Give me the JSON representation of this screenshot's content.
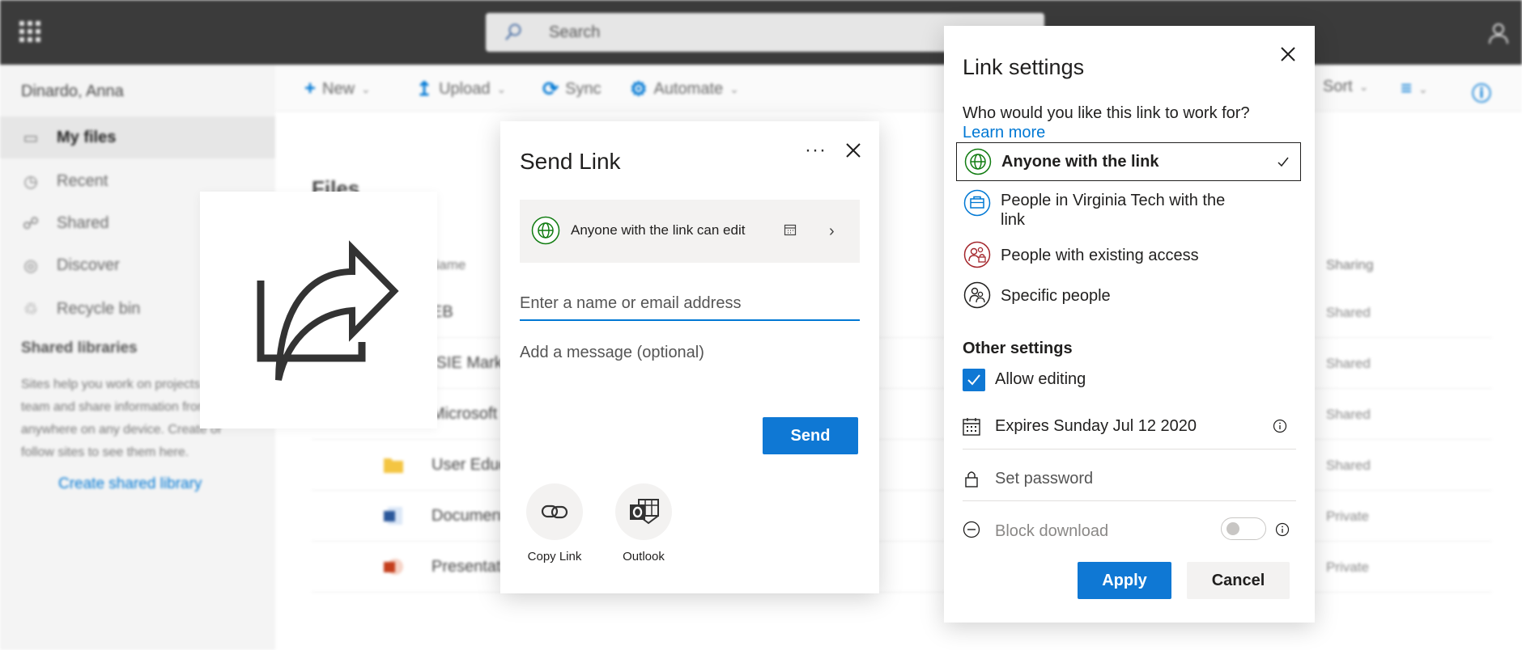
{
  "app": {
    "search_placeholder": "Search",
    "user_name": "Dinardo, Anna",
    "commands": [
      {
        "label": "New",
        "icon": "plus-icon"
      },
      {
        "label": "Upload",
        "icon": "upload-icon"
      },
      {
        "label": "Sync",
        "icon": "sync-icon"
      },
      {
        "label": "Automate",
        "icon": "automate-icon"
      },
      {
        "label": "Sort",
        "icon": "sort-icon"
      }
    ],
    "nav": [
      {
        "label": "My files",
        "icon": "folder-icon",
        "active": true
      },
      {
        "label": "Recent",
        "icon": "clock-icon"
      },
      {
        "label": "Shared",
        "icon": "people-icon"
      },
      {
        "label": "Discover",
        "icon": "discover-icon"
      },
      {
        "label": "Recycle bin",
        "icon": "recycle-bin-icon"
      }
    ],
    "shared_libraries": {
      "heading": "Shared libraries",
      "description": "Sites help you work on projects with your team and share information from anywhere on any device. Create or follow sites to see them here.",
      "create_link": "Create shared library"
    },
    "files": {
      "title": "Files",
      "col_name": "Name",
      "col_sharing": "Sharing",
      "rows": [
        {
          "name": "EB",
          "sharing": "Shared",
          "icon": "folder-icon"
        },
        {
          "name": "ISIE Marketing",
          "sharing": "Shared",
          "icon": "folder-icon"
        },
        {
          "name": "Microsoft",
          "sharing": "Shared",
          "icon": "folder-icon"
        },
        {
          "name": "User Education",
          "sharing": "Shared",
          "icon": "folder-icon"
        },
        {
          "name": "Document",
          "sharing": "Private",
          "icon": "word-icon"
        },
        {
          "name": "Presentation",
          "sharing": "Private",
          "icon": "powerpoint-icon"
        }
      ]
    }
  },
  "send_link": {
    "title": "Send Link",
    "more": "···",
    "permission": "Anyone with the link can edit",
    "to_placeholder": "Enter a name or email address",
    "message_placeholder": "Add a message (optional)",
    "send_label": "Send",
    "actions": [
      {
        "label": "Copy Link",
        "icon": "link-icon"
      },
      {
        "label": "Outlook",
        "icon": "outlook-icon"
      }
    ]
  },
  "link_settings": {
    "title": "Link settings",
    "question": "Who would you like this link to work for?",
    "learn_more": "Learn more",
    "options": [
      {
        "label": "Anyone with the link",
        "icon": "globe-icon",
        "selected": true
      },
      {
        "label": "People in Virginia Tech with the link",
        "icon": "organization-icon",
        "selected": false
      },
      {
        "label": "People with existing access",
        "icon": "existing-access-icon",
        "selected": false
      },
      {
        "label": "Specific people",
        "icon": "specific-people-icon",
        "selected": false
      }
    ],
    "other_settings": "Other settings",
    "allow_editing": "Allow editing",
    "allow_editing_checked": true,
    "expires": "Expires Sunday Jul 12 2020",
    "password_placeholder": "Set password",
    "block_download": "Block download",
    "block_download_on": false,
    "apply_label": "Apply",
    "cancel_label": "Cancel"
  },
  "colors": {
    "accent": "#0f78d4",
    "topbar": "#3b3b3b",
    "globe": "#107c10",
    "organization": "#0078d4",
    "existing_access": "#a4262c"
  }
}
